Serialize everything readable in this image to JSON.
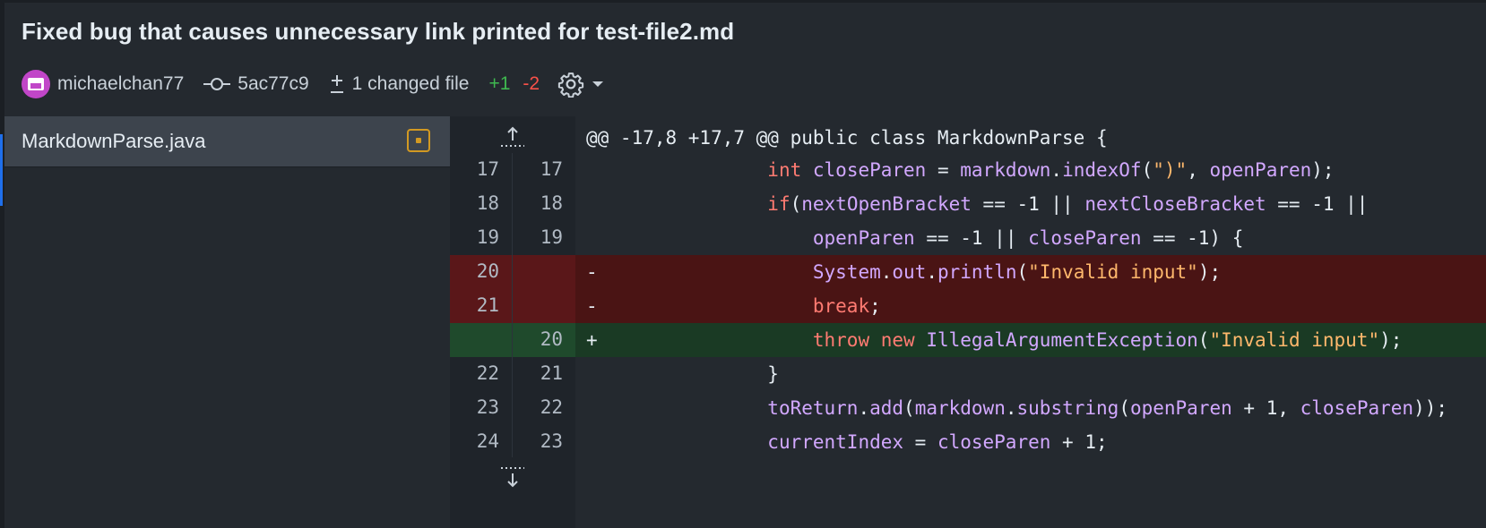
{
  "commit": {
    "title": "Fixed bug that causes unnecessary link printed for test-file2.md",
    "author": "michaelchan77",
    "hash": "5ac77c9",
    "changed_files": "1 changed file",
    "additions": "+1",
    "deletions": "-2"
  },
  "files": [
    {
      "name": "MarkdownParse.java",
      "status": "modified"
    }
  ],
  "diff": {
    "hunk_header": "@@ -17,8 +17,7 @@ public class MarkdownParse {",
    "lines": [
      {
        "type": "context",
        "old": "17",
        "new": "17",
        "sign": "",
        "tokens": [
          [
            "",
            "                "
          ],
          [
            "kw",
            "int"
          ],
          [
            "pl",
            " "
          ],
          [
            "id",
            "closeParen"
          ],
          [
            "pl",
            " = "
          ],
          [
            "id",
            "markdown"
          ],
          [
            "pl",
            "."
          ],
          [
            "id",
            "indexOf"
          ],
          [
            "pl",
            "("
          ],
          [
            "str",
            "\")\""
          ],
          [
            "pl",
            ", "
          ],
          [
            "id",
            "openParen"
          ],
          [
            "pl",
            ");"
          ]
        ]
      },
      {
        "type": "context",
        "old": "18",
        "new": "18",
        "sign": "",
        "tokens": [
          [
            "",
            "                "
          ],
          [
            "kw",
            "if"
          ],
          [
            "pl",
            "("
          ],
          [
            "id",
            "nextOpenBracket"
          ],
          [
            "pl",
            " == -1 || "
          ],
          [
            "id",
            "nextCloseBracket"
          ],
          [
            "pl",
            " == -1 ||"
          ]
        ]
      },
      {
        "type": "context",
        "old": "19",
        "new": "19",
        "sign": "",
        "tokens": [
          [
            "",
            "                    "
          ],
          [
            "id",
            "openParen"
          ],
          [
            "pl",
            " == -1 || "
          ],
          [
            "id",
            "closeParen"
          ],
          [
            "pl",
            " == -1) {"
          ]
        ]
      },
      {
        "type": "deletion",
        "old": "20",
        "new": "",
        "sign": "-",
        "tokens": [
          [
            "",
            "                    "
          ],
          [
            "id",
            "System"
          ],
          [
            "pl",
            "."
          ],
          [
            "id",
            "out"
          ],
          [
            "pl",
            "."
          ],
          [
            "id",
            "println"
          ],
          [
            "pl",
            "("
          ],
          [
            "str",
            "\"Invalid input\""
          ],
          [
            "pl",
            ");"
          ]
        ]
      },
      {
        "type": "deletion",
        "old": "21",
        "new": "",
        "sign": "-",
        "tokens": [
          [
            "",
            "                    "
          ],
          [
            "kw",
            "break"
          ],
          [
            "pl",
            ";"
          ]
        ]
      },
      {
        "type": "addition",
        "old": "",
        "new": "20",
        "sign": "+",
        "tokens": [
          [
            "",
            "                    "
          ],
          [
            "kw",
            "throw"
          ],
          [
            "pl",
            " "
          ],
          [
            "kw",
            "new"
          ],
          [
            "pl",
            " "
          ],
          [
            "id",
            "IllegalArgumentException"
          ],
          [
            "pl",
            "("
          ],
          [
            "str",
            "\"Invalid input\""
          ],
          [
            "pl",
            ");"
          ]
        ]
      },
      {
        "type": "context",
        "old": "22",
        "new": "21",
        "sign": "",
        "tokens": [
          [
            "",
            "                "
          ],
          [
            "pl",
            "}"
          ]
        ]
      },
      {
        "type": "context",
        "old": "23",
        "new": "22",
        "sign": "",
        "tokens": [
          [
            "",
            "                "
          ],
          [
            "id",
            "toReturn"
          ],
          [
            "pl",
            "."
          ],
          [
            "id",
            "add"
          ],
          [
            "pl",
            "("
          ],
          [
            "id",
            "markdown"
          ],
          [
            "pl",
            "."
          ],
          [
            "id",
            "substring"
          ],
          [
            "pl",
            "("
          ],
          [
            "id",
            "openParen"
          ],
          [
            "pl",
            " + 1, "
          ],
          [
            "id",
            "closeParen"
          ],
          [
            "pl",
            "));"
          ]
        ]
      },
      {
        "type": "context",
        "old": "24",
        "new": "23",
        "sign": "",
        "tokens": [
          [
            "",
            "                "
          ],
          [
            "id",
            "currentIndex"
          ],
          [
            "pl",
            " = "
          ],
          [
            "id",
            "closeParen"
          ],
          [
            "pl",
            " + 1;"
          ]
        ]
      }
    ]
  },
  "colors": {
    "addition": "#3fb950",
    "deletion": "#f85149",
    "modified_badge": "#d29922"
  },
  "icons": {
    "author_avatar": "avatar-icon",
    "commit": "git-commit-icon",
    "changed_files": "diff-icon",
    "settings": "gear-icon",
    "expand_up": "expand-up-icon",
    "expand_down": "expand-down-icon",
    "file_status": "file-diff-modified-icon"
  }
}
